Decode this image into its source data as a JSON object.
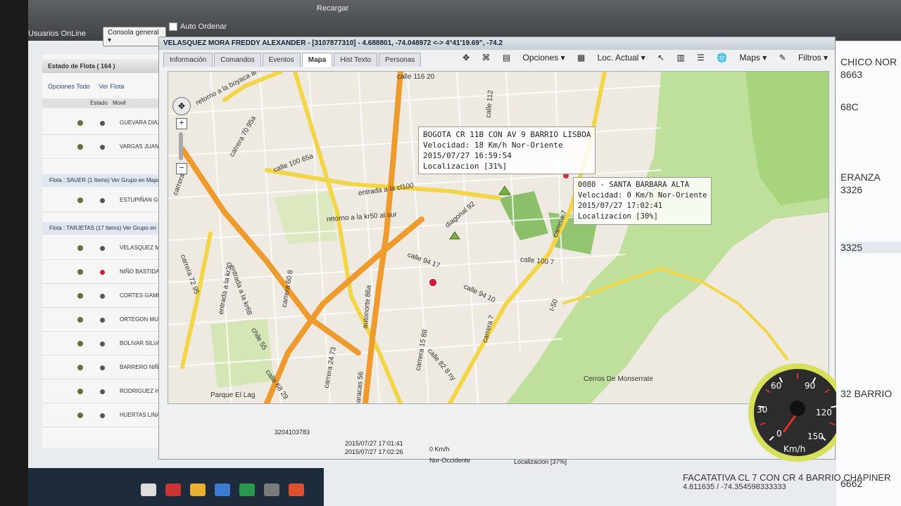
{
  "topbar": {
    "status_label": "Usuarios OnLine",
    "console_combo": "Consola general",
    "auto_order": "Auto Ordenar",
    "reload": "Recargar",
    "coords": "4.688801, -74.048972 <-> 4°41'19.69\", -74.2"
  },
  "sidebar": {
    "title": "Estado de Flota ( 164 )",
    "tools": [
      "Opciones Todo",
      "Ver Flota"
    ],
    "head": [
      "Estado",
      "Movil"
    ],
    "rows": [
      {
        "name": "GUEVARA DIAZ JULI",
        "alert": false
      },
      {
        "name": "VARGAS JUAN CAR",
        "alert": false
      }
    ],
    "group1": "Flota : SAUER (1 Items)   Ver Grupo en Mapa",
    "rows2": [
      {
        "name": "ESTUPIÑAN GUEVAR",
        "alert": false
      }
    ],
    "group2": "Flota : TARJETAS (17 Items)   Ver Grupo en",
    "rows3": [
      {
        "name": "VELASQUEZ MORA F",
        "alert": false
      },
      {
        "name": "NIÑO BASTIDAS LIN",
        "alert": true
      },
      {
        "name": "CORTES GAMBA CA",
        "alert": false
      },
      {
        "name": "ORTEGON MUÑOZ C",
        "alert": false
      },
      {
        "name": "BOLIVAR SILVA PEDI",
        "alert": false
      },
      {
        "name": "BARRERO NIÑO JHO",
        "alert": false
      },
      {
        "name": "RODRIGUEZ HENRY",
        "alert": false
      },
      {
        "name": "HUERTAS LINARES GUIDO LIZARDO",
        "alert": false
      }
    ]
  },
  "panel": {
    "title": "VELASQUEZ MORA FREDDY ALEXANDER - [3107877310] - 4.688801, -74.048972 <-> 4°41'19.69\", -74.2",
    "tabs": [
      "Información",
      "Comandos",
      "Eventos",
      "Mapa",
      "Hist Texto",
      "Personas"
    ],
    "active_tab": "Mapa",
    "tools": {
      "options": "Opciones",
      "location": "Loc. Actual",
      "maps": "Maps",
      "filters": "Filtros"
    }
  },
  "map": {
    "streets": [
      "calle 116 20",
      "retorno a la boyaca al norte",
      "carrera 70 95a",
      "calle 100 65a",
      "entrada a la cl100",
      "retorno a la kr50 al sur",
      "diagonal 92",
      "calle 94 17",
      "calle 94 10",
      "calle 100 7",
      "carrera 7",
      "entrada a la kr68",
      "autonorte 86a",
      "carrera 15 88",
      "carrera 24 73",
      "chile 55",
      "calle 82 8 ny",
      "carrera 7",
      "I-50",
      "Cerros De Monserrate",
      "Parque El Lag",
      "caracas 56",
      "calle 68 29",
      "calle 112",
      "carrera 70",
      "entrada a la kr30",
      "carrera 60 8",
      "carrera 72 95"
    ],
    "popups": [
      {
        "lines": [
          "BOGOTA CR 11B CON AV 9 BARRIO LISBOA",
          "Velocidad: 18 Km/h Nor-Oriente",
          "2015/07/27 16:59:54",
          "Localizacion [31%]"
        ]
      },
      {
        "lines": [
          "0080 - SANTA BARBARA ALTA",
          "Velocidad: 0 Km/h Nor-Oriente",
          "2015/07/27 17:02:41",
          "Localizacion [30%]"
        ]
      }
    ],
    "colors": {
      "background": "#eeeae1",
      "park": "#cfe3a8",
      "arterial": "#f0a432",
      "primary": "#f5d84a",
      "forest": "#b9d98c"
    }
  },
  "gauge": {
    "unit": "Km/h",
    "ticks": [
      "0",
      "30",
      "60",
      "90",
      "120",
      "150"
    ],
    "value": 0
  },
  "bottom": {
    "phone": "3204103783",
    "time1": "2015/07/27 17:01:41",
    "time2": "2015/07/27 17:02:26",
    "speed": "0 Km/h",
    "heading": "Nor-Occidente",
    "loc": "Localizacion [37%]"
  },
  "right": {
    "items": [
      "CHICO NOR",
      "8663",
      "68C",
      "ERANZA",
      "3326",
      "3325",
      "32 BARRIO",
      "6662"
    ],
    "bottom_text": "FACATATIVA CL 7 CON CR 4 BARRIO CHAPINER",
    "bottom_coords": "4.811635 / -74.354598333333"
  }
}
